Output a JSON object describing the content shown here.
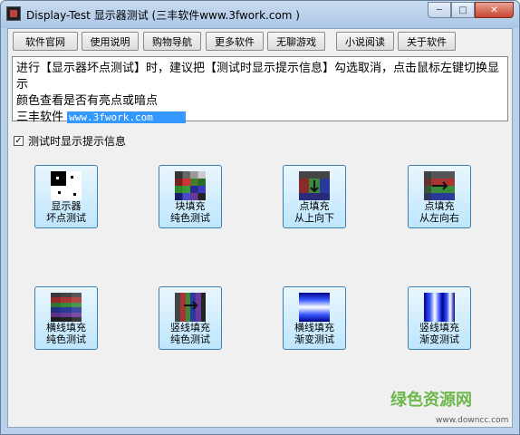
{
  "window": {
    "title": "Display-Test 显示器测试 (三丰软件www.3fwork.com )",
    "controls": {
      "minimize": "─",
      "maximize": "□",
      "close": "✕"
    }
  },
  "toolbar": {
    "buttons": [
      "软件官网",
      "使用说明",
      "购物导航",
      "更多软件",
      "无聊游戏",
      "小说阅读",
      "关于软件"
    ]
  },
  "info": {
    "line1": "进行【显示器坏点测试】时，建议把【测试时显示提示信息】勾选取消，点击鼠标左键切换显示",
    "line2": "颜色查看是否有亮点或暗点",
    "brand": "三丰软件",
    "url": "www.3fwork.com"
  },
  "option": {
    "label": "测试时显示提示信息",
    "checked": "✓"
  },
  "tests": [
    {
      "line1": "显示器",
      "line2": "坏点测试",
      "icon": "dead-pixel-icon"
    },
    {
      "line1": "块填充",
      "line2": "纯色测试",
      "icon": "block-fill-icon"
    },
    {
      "line1": "点填充",
      "line2": "从上向下",
      "icon": "point-fill-top-down-icon"
    },
    {
      "line1": "点填充",
      "line2": "从左向右",
      "icon": "point-fill-left-right-icon"
    },
    {
      "line1": "横线填充",
      "line2": "纯色测试",
      "icon": "horizontal-line-solid-icon"
    },
    {
      "line1": "竖线填充",
      "line2": "纯色测试",
      "icon": "vertical-line-solid-icon"
    },
    {
      "line1": "横线填充",
      "line2": "渐变测试",
      "icon": "horizontal-gradient-icon"
    },
    {
      "line1": "竖线填充",
      "line2": "渐变测试",
      "icon": "vertical-gradient-icon"
    }
  ],
  "watermark": {
    "text": "绿色资源网",
    "url": "www.downcc.com"
  }
}
